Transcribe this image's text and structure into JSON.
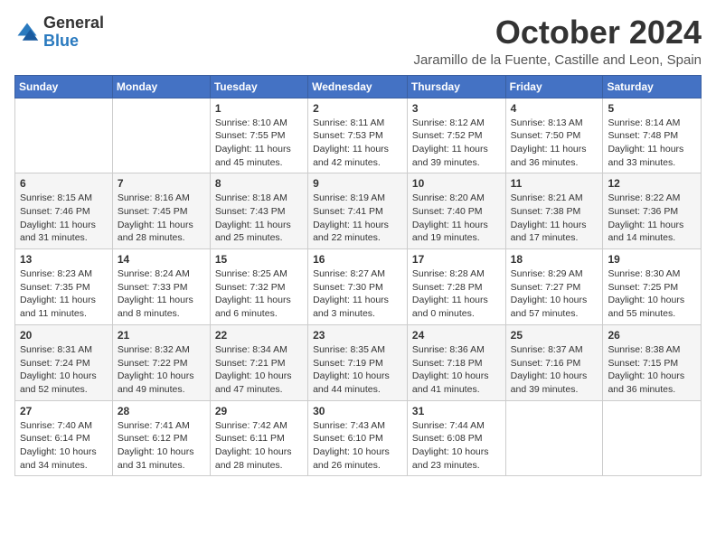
{
  "header": {
    "logo_general": "General",
    "logo_blue": "Blue",
    "month_title": "October 2024",
    "location": "Jaramillo de la Fuente, Castille and Leon, Spain"
  },
  "days_of_week": [
    "Sunday",
    "Monday",
    "Tuesday",
    "Wednesday",
    "Thursday",
    "Friday",
    "Saturday"
  ],
  "weeks": [
    [
      {
        "day": "",
        "detail": ""
      },
      {
        "day": "",
        "detail": ""
      },
      {
        "day": "1",
        "detail": "Sunrise: 8:10 AM\nSunset: 7:55 PM\nDaylight: 11 hours and 45 minutes."
      },
      {
        "day": "2",
        "detail": "Sunrise: 8:11 AM\nSunset: 7:53 PM\nDaylight: 11 hours and 42 minutes."
      },
      {
        "day": "3",
        "detail": "Sunrise: 8:12 AM\nSunset: 7:52 PM\nDaylight: 11 hours and 39 minutes."
      },
      {
        "day": "4",
        "detail": "Sunrise: 8:13 AM\nSunset: 7:50 PM\nDaylight: 11 hours and 36 minutes."
      },
      {
        "day": "5",
        "detail": "Sunrise: 8:14 AM\nSunset: 7:48 PM\nDaylight: 11 hours and 33 minutes."
      }
    ],
    [
      {
        "day": "6",
        "detail": "Sunrise: 8:15 AM\nSunset: 7:46 PM\nDaylight: 11 hours and 31 minutes."
      },
      {
        "day": "7",
        "detail": "Sunrise: 8:16 AM\nSunset: 7:45 PM\nDaylight: 11 hours and 28 minutes."
      },
      {
        "day": "8",
        "detail": "Sunrise: 8:18 AM\nSunset: 7:43 PM\nDaylight: 11 hours and 25 minutes."
      },
      {
        "day": "9",
        "detail": "Sunrise: 8:19 AM\nSunset: 7:41 PM\nDaylight: 11 hours and 22 minutes."
      },
      {
        "day": "10",
        "detail": "Sunrise: 8:20 AM\nSunset: 7:40 PM\nDaylight: 11 hours and 19 minutes."
      },
      {
        "day": "11",
        "detail": "Sunrise: 8:21 AM\nSunset: 7:38 PM\nDaylight: 11 hours and 17 minutes."
      },
      {
        "day": "12",
        "detail": "Sunrise: 8:22 AM\nSunset: 7:36 PM\nDaylight: 11 hours and 14 minutes."
      }
    ],
    [
      {
        "day": "13",
        "detail": "Sunrise: 8:23 AM\nSunset: 7:35 PM\nDaylight: 11 hours and 11 minutes."
      },
      {
        "day": "14",
        "detail": "Sunrise: 8:24 AM\nSunset: 7:33 PM\nDaylight: 11 hours and 8 minutes."
      },
      {
        "day": "15",
        "detail": "Sunrise: 8:25 AM\nSunset: 7:32 PM\nDaylight: 11 hours and 6 minutes."
      },
      {
        "day": "16",
        "detail": "Sunrise: 8:27 AM\nSunset: 7:30 PM\nDaylight: 11 hours and 3 minutes."
      },
      {
        "day": "17",
        "detail": "Sunrise: 8:28 AM\nSunset: 7:28 PM\nDaylight: 11 hours and 0 minutes."
      },
      {
        "day": "18",
        "detail": "Sunrise: 8:29 AM\nSunset: 7:27 PM\nDaylight: 10 hours and 57 minutes."
      },
      {
        "day": "19",
        "detail": "Sunrise: 8:30 AM\nSunset: 7:25 PM\nDaylight: 10 hours and 55 minutes."
      }
    ],
    [
      {
        "day": "20",
        "detail": "Sunrise: 8:31 AM\nSunset: 7:24 PM\nDaylight: 10 hours and 52 minutes."
      },
      {
        "day": "21",
        "detail": "Sunrise: 8:32 AM\nSunset: 7:22 PM\nDaylight: 10 hours and 49 minutes."
      },
      {
        "day": "22",
        "detail": "Sunrise: 8:34 AM\nSunset: 7:21 PM\nDaylight: 10 hours and 47 minutes."
      },
      {
        "day": "23",
        "detail": "Sunrise: 8:35 AM\nSunset: 7:19 PM\nDaylight: 10 hours and 44 minutes."
      },
      {
        "day": "24",
        "detail": "Sunrise: 8:36 AM\nSunset: 7:18 PM\nDaylight: 10 hours and 41 minutes."
      },
      {
        "day": "25",
        "detail": "Sunrise: 8:37 AM\nSunset: 7:16 PM\nDaylight: 10 hours and 39 minutes."
      },
      {
        "day": "26",
        "detail": "Sunrise: 8:38 AM\nSunset: 7:15 PM\nDaylight: 10 hours and 36 minutes."
      }
    ],
    [
      {
        "day": "27",
        "detail": "Sunrise: 7:40 AM\nSunset: 6:14 PM\nDaylight: 10 hours and 34 minutes."
      },
      {
        "day": "28",
        "detail": "Sunrise: 7:41 AM\nSunset: 6:12 PM\nDaylight: 10 hours and 31 minutes."
      },
      {
        "day": "29",
        "detail": "Sunrise: 7:42 AM\nSunset: 6:11 PM\nDaylight: 10 hours and 28 minutes."
      },
      {
        "day": "30",
        "detail": "Sunrise: 7:43 AM\nSunset: 6:10 PM\nDaylight: 10 hours and 26 minutes."
      },
      {
        "day": "31",
        "detail": "Sunrise: 7:44 AM\nSunset: 6:08 PM\nDaylight: 10 hours and 23 minutes."
      },
      {
        "day": "",
        "detail": ""
      },
      {
        "day": "",
        "detail": ""
      }
    ]
  ]
}
